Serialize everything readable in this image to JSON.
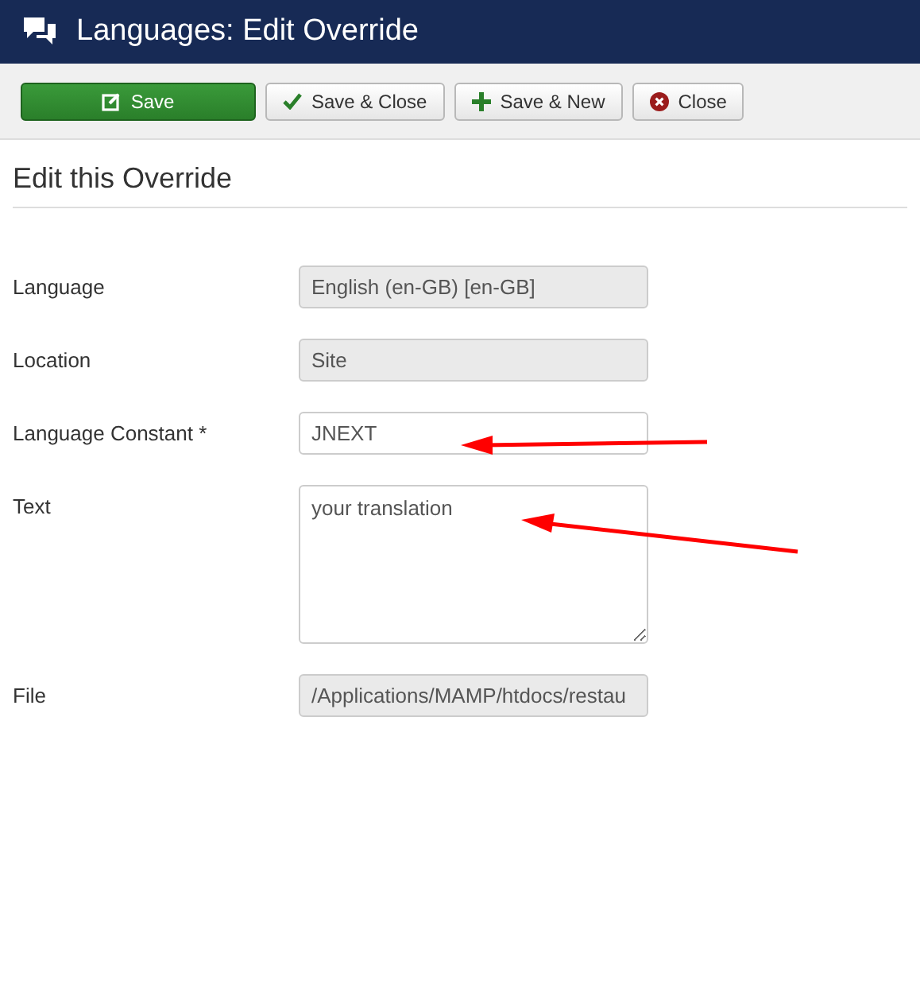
{
  "header": {
    "title": "Languages: Edit Override"
  },
  "toolbar": [
    {
      "label": "Save",
      "kind": "save"
    },
    {
      "label": "Save & Close",
      "kind": "saveclose"
    },
    {
      "label": "Save & New",
      "kind": "savenew"
    },
    {
      "label": "Close",
      "kind": "close"
    }
  ],
  "form": {
    "title": "Edit this Override",
    "fields": [
      {
        "label": "Language",
        "value": "English (en-GB) [en-GB]",
        "kind": "input",
        "disabled": true
      },
      {
        "label": "Location",
        "value": "Site",
        "kind": "input",
        "disabled": true
      },
      {
        "label": "Language Constant *",
        "value": "JNEXT",
        "kind": "input",
        "disabled": false
      },
      {
        "label": "Text",
        "value": "your translation",
        "kind": "textarea",
        "disabled": false
      },
      {
        "label": "File",
        "value": "/Applications/MAMP/htdocs/restau",
        "kind": "input",
        "disabled": true
      }
    ]
  }
}
